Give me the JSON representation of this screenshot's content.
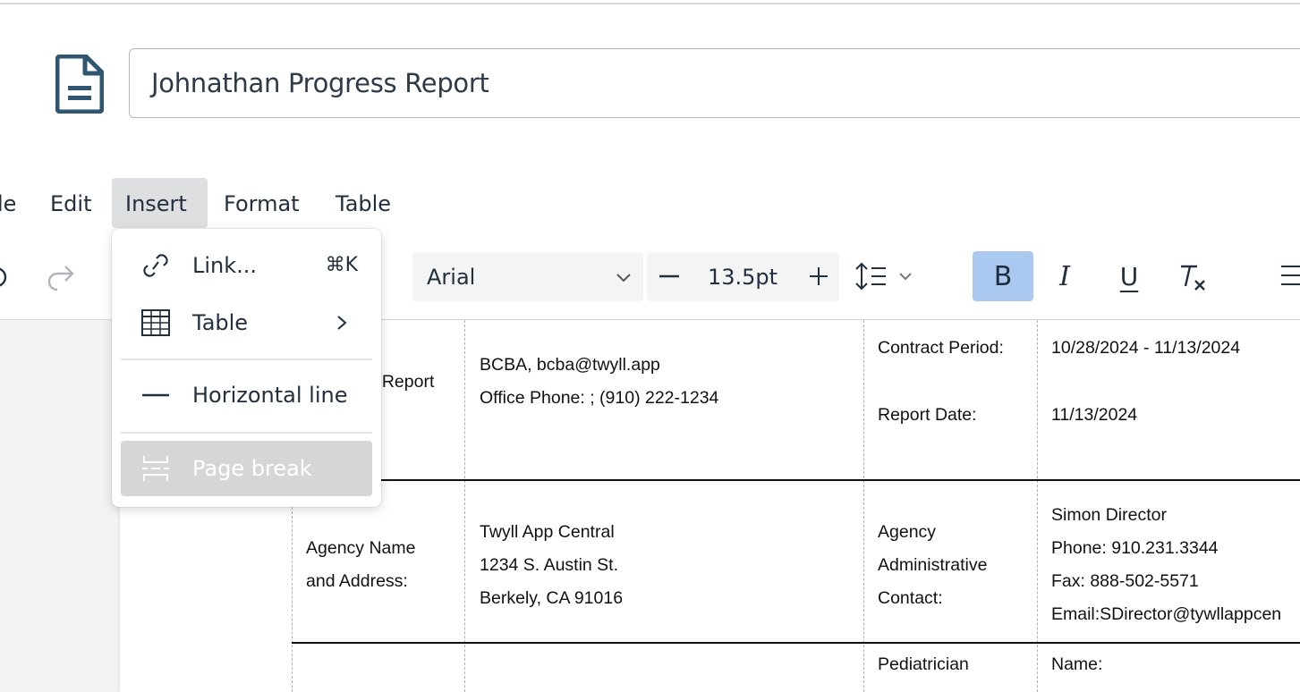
{
  "document": {
    "title": "Johnathan Progress Report"
  },
  "menubar": {
    "items": [
      {
        "label": "le",
        "active": false
      },
      {
        "label": "Edit",
        "active": false
      },
      {
        "label": "Insert",
        "active": true
      },
      {
        "label": "Format",
        "active": false
      },
      {
        "label": "Table",
        "active": false
      }
    ]
  },
  "toolbar": {
    "font_family": "Arial",
    "font_size": "13.5pt",
    "bold_active": true,
    "icons": [
      "undo-icon",
      "redo-icon",
      "font-chevron-icon",
      "decrease-size-icon",
      "increase-size-icon",
      "line-height-icon",
      "bold-icon",
      "italic-icon",
      "underline-icon",
      "clear-formatting-icon",
      "align-icon"
    ],
    "bold_label": "B",
    "italic_label": "I",
    "underline_label": "U"
  },
  "insert_menu": {
    "items": [
      {
        "icon": "link-icon",
        "label": "Link...",
        "shortcut": "⌘K",
        "disabled": false
      },
      {
        "icon": "table-icon",
        "label": "Table",
        "submenu": true,
        "disabled": false
      },
      {
        "icon": "horizontal-line-icon",
        "label": "Horizontal line",
        "disabled": false
      },
      {
        "icon": "page-break-icon",
        "label": "Page break",
        "disabled": true
      }
    ]
  },
  "report_table": {
    "row1": {
      "label_partial": "f Report",
      "contact_line1": "BCBA, bcba@twyll.app",
      "contact_line2": "Office Phone: ; (910) 222-1234",
      "contract_period_label": "Contract Period:",
      "contract_period_value": "10/28/2024 - 11/13/2024",
      "report_date_label": "Report Date:",
      "report_date_value": "11/13/2024"
    },
    "row2": {
      "label_line1": "Agency Name",
      "label_line2": "and Address:",
      "agency_line1": "Twyll App Central",
      "agency_line2": "1234 S. Austin St.",
      "agency_line3": "Berkely, CA 91016",
      "admin_label_line1": "Agency",
      "admin_label_line2": "Administrative",
      "admin_label_line3": "Contact:",
      "admin_line1": "Simon Director",
      "admin_line2": "Phone: 910.231.3344",
      "admin_line3": "Fax: 888-502-5571",
      "admin_line4": "Email:SDirector@tywllappcen"
    },
    "row3": {
      "pediatrician_label": "Pediatrician",
      "name_label": "Name:"
    }
  }
}
